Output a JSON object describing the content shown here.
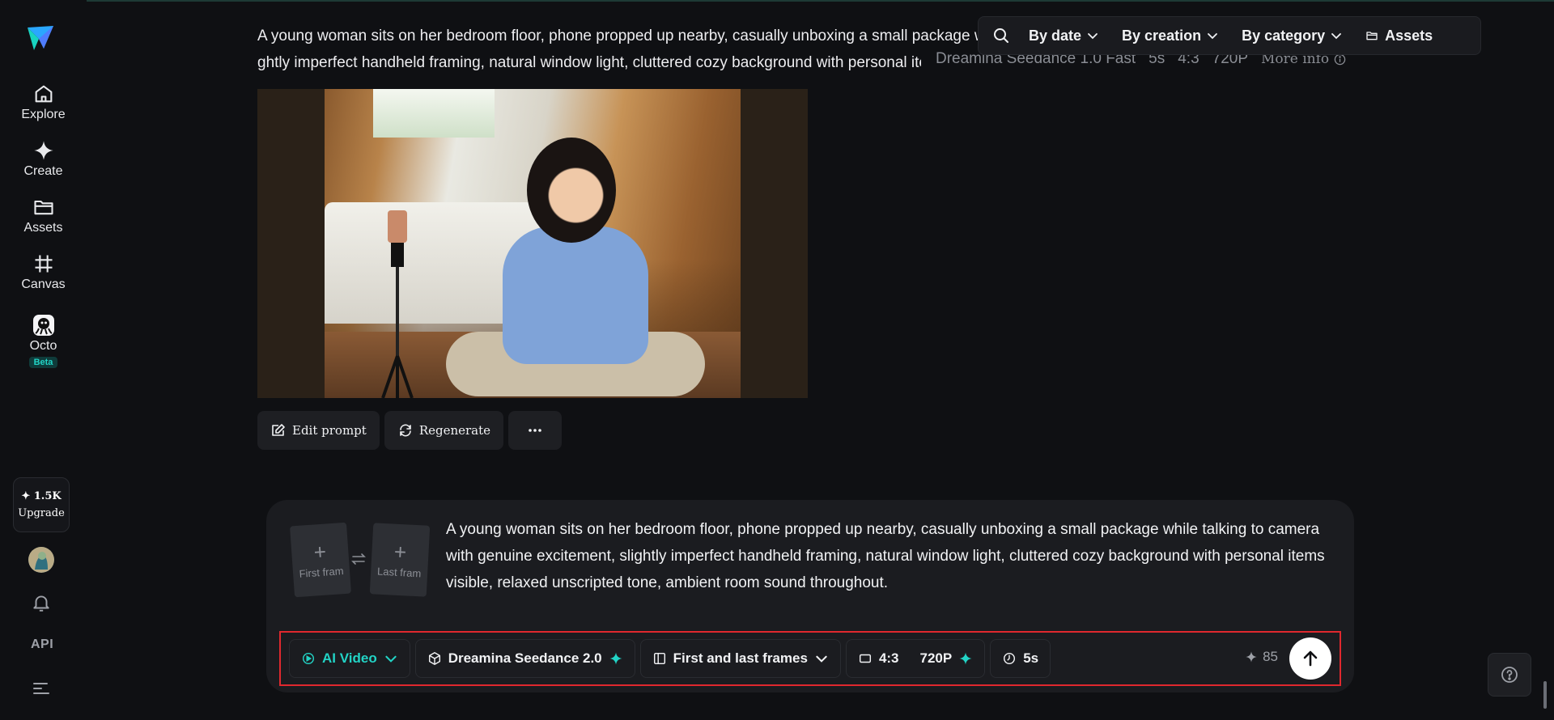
{
  "sidebar": {
    "items": [
      {
        "label": "Explore",
        "icon": "home-icon"
      },
      {
        "label": "Create",
        "icon": "sparkle-icon"
      },
      {
        "label": "Assets",
        "icon": "folder-icon"
      },
      {
        "label": "Canvas",
        "icon": "canvas-icon"
      },
      {
        "label": "Octo",
        "icon": "octo-icon"
      }
    ],
    "beta": "Beta",
    "credits": "1.5K",
    "upgrade": "Upgrade",
    "api": "API"
  },
  "post": {
    "prompt_line1": "A young woman sits on her bedroom floor, phone propped up nearby, casually unboxing a small package while talking to",
    "prompt_line2": "ghtly imperfect handheld framing, natural window light, cluttered cozy background with personal items visible",
    "model": "Dreamina Seedance 1.0 Fast",
    "duration": "5s",
    "ratio": "4:3",
    "resolution": "720P",
    "more_info": "More info"
  },
  "filters": {
    "by_date": "By date",
    "by_creation": "By creation",
    "by_category": "By category",
    "assets": "Assets"
  },
  "actions": {
    "edit_prompt": "Edit prompt",
    "regenerate": "Regenerate"
  },
  "composer": {
    "first_frame": "First fram",
    "last_frame": "Last fram",
    "prompt": "A young woman sits on her bedroom floor, phone propped up nearby, casually unboxing a small package while talking to camera with genuine excitement, slightly imperfect handheld framing, natural window light, cluttered cozy background with personal items visible, relaxed unscripted tone, ambient room sound throughout.",
    "mode": "AI Video",
    "model": "Dreamina Seedance 2.0",
    "frames_mode": "First and last frames",
    "ratio": "4:3",
    "resolution": "720P",
    "duration": "5s",
    "cost": "85"
  },
  "colors": {
    "accent": "#22d3c5",
    "highlight_box": "#e0282e",
    "background": "#0f1013"
  }
}
